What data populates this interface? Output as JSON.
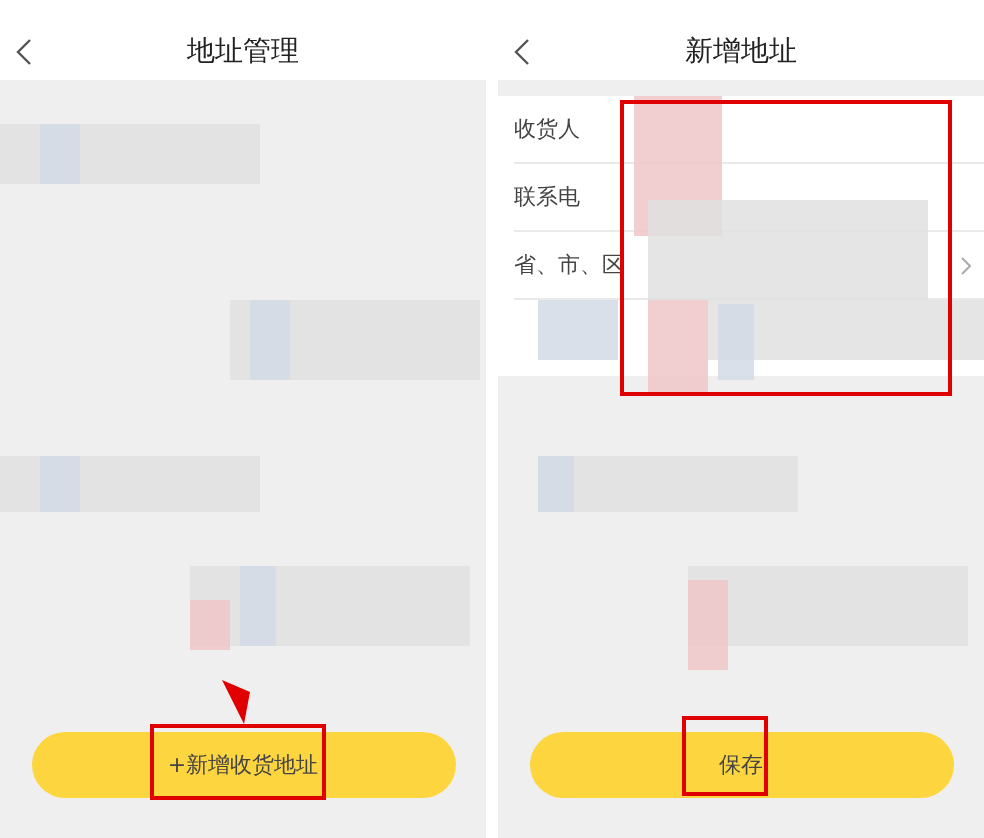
{
  "screens": [
    {
      "title": "地址管理",
      "button": {
        "label": "+新增收货地址"
      }
    },
    {
      "title": "新增地址",
      "form_rows": [
        {
          "label": "收货人",
          "kind": "text"
        },
        {
          "label": "联系电",
          "kind": "text"
        },
        {
          "label": "省、市、区",
          "kind": "picker"
        },
        {
          "kind": "text"
        }
      ],
      "button": {
        "label": "保存"
      }
    }
  ]
}
